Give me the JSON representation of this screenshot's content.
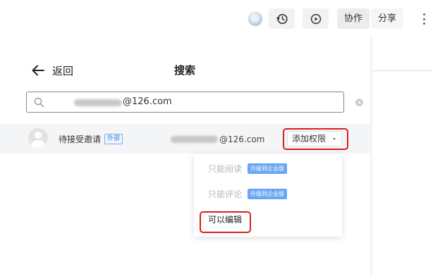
{
  "toolbar": {
    "collab_label": "协作",
    "share_label": "分享",
    "icons": [
      "history-icon",
      "play-icon",
      "more-icon"
    ]
  },
  "panel": {
    "back_label": "返回",
    "title": "搜索"
  },
  "search": {
    "query_suffix": "@126.com",
    "blurred": true
  },
  "result_row": {
    "name": "待接受邀请",
    "badge": "外部",
    "email_suffix": "@126.com",
    "permission_button": "添加权限"
  },
  "menu": {
    "items": [
      {
        "label": "只能阅读",
        "upgrade": "升级到企业版",
        "disabled": true
      },
      {
        "label": "只能评论",
        "upgrade": "升级到企业版",
        "disabled": true
      },
      {
        "label": "可以编辑",
        "disabled": false
      }
    ]
  },
  "colors": {
    "highlight": "#d81e1e",
    "upgrade_badge": "#6aa7f3",
    "external_badge": "#3c82e0"
  }
}
